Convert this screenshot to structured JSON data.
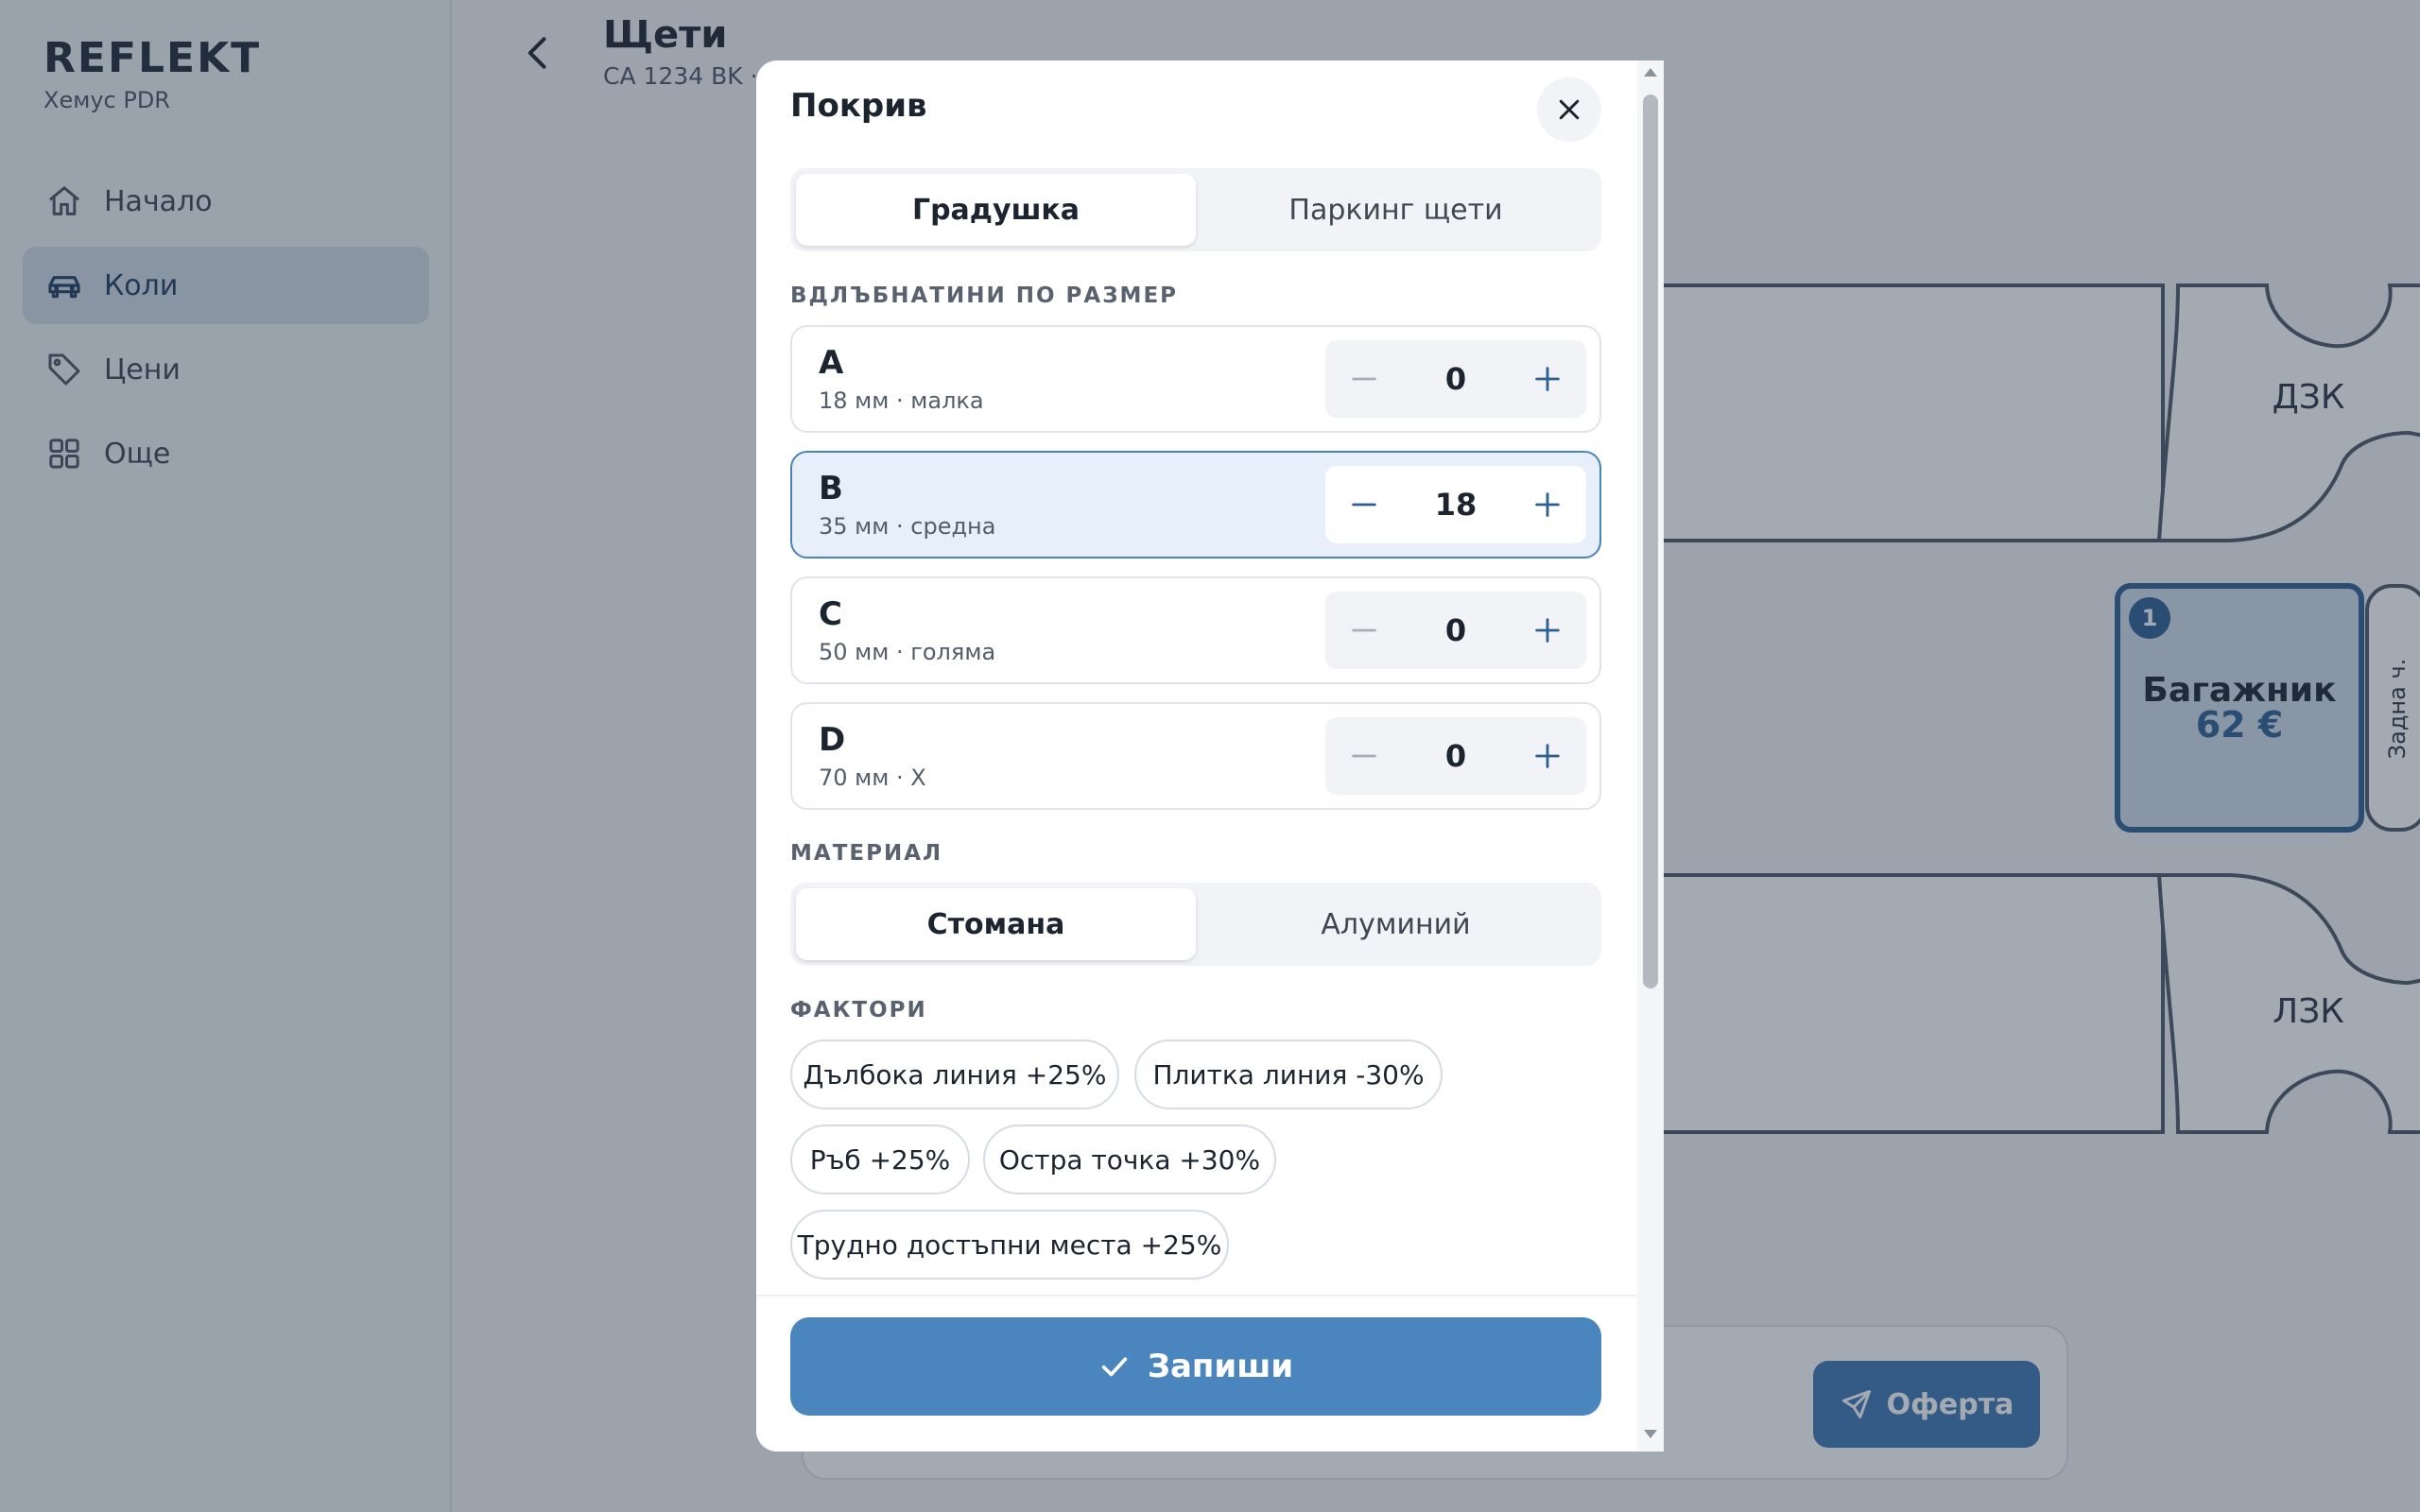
{
  "brand": {
    "logo": "REFLEKT",
    "subtitle": "Хемус PDR"
  },
  "nav": {
    "items": [
      {
        "label": "Начало",
        "icon": "home-icon",
        "active": false
      },
      {
        "label": "Коли",
        "icon": "car-icon",
        "active": true
      },
      {
        "label": "Цени",
        "icon": "tag-icon",
        "active": false
      },
      {
        "label": "Още",
        "icon": "grid-icon",
        "active": false
      }
    ]
  },
  "page": {
    "title": "Щети",
    "subtitle": "CA 1234 BK · …"
  },
  "diagram": {
    "panels": {
      "rear_right_fender": "ДЗК",
      "rear_left_fender": "ЛЗК",
      "rear_bumper": "Задна ч."
    },
    "trunk": {
      "label": "Багажник",
      "price": "62 €",
      "badge": "1"
    }
  },
  "bottom": {
    "offer_label": "Оферта"
  },
  "modal": {
    "title": "Покрив",
    "damage_types": [
      {
        "label": "Градушка",
        "active": true
      },
      {
        "label": "Паркинг щети",
        "active": false
      }
    ],
    "dents_label": "ВДЛЪБНАТИНИ ПО РАЗМЕР",
    "dents": [
      {
        "name": "A",
        "desc": "18 мм · малка",
        "count": "0"
      },
      {
        "name": "B",
        "desc": "35 мм · средна",
        "count": "18"
      },
      {
        "name": "C",
        "desc": "50 мм · голяма",
        "count": "0"
      },
      {
        "name": "D",
        "desc": "70 мм · X",
        "count": "0"
      }
    ],
    "material_label": "МАТЕРИАЛ",
    "materials": [
      {
        "label": "Стомана",
        "active": true
      },
      {
        "label": "Алуминий",
        "active": false
      }
    ],
    "factors_label": "ФАКТОРИ",
    "factors": [
      "Дълбока линия +25%",
      "Плитка линия -30%",
      "Ръб +25%",
      "Остра точка +30%",
      "Трудно достъпни места +25%"
    ],
    "save_label": "Запиши"
  },
  "colors": {
    "accent": "#4a86bd",
    "selected_bg": "#e7f0fa",
    "selected_border": "#4a82ba",
    "trunk_fill": "#cfdcea"
  }
}
